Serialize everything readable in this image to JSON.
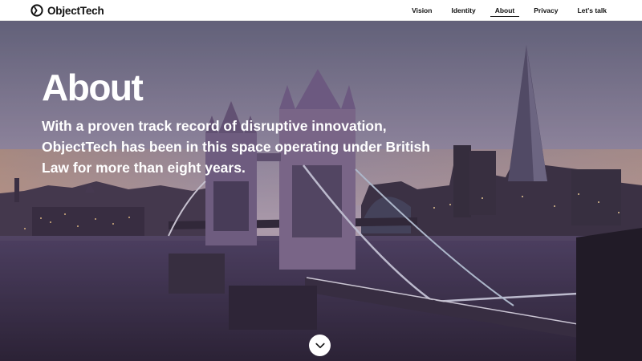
{
  "brand": {
    "name": "ObjectTech",
    "logo_icon": "objecttech-logo-icon"
  },
  "nav": {
    "items": [
      {
        "label": "Vision",
        "active": false
      },
      {
        "label": "Identity",
        "active": false
      },
      {
        "label": "About",
        "active": true
      },
      {
        "label": "Privacy",
        "active": false
      },
      {
        "label": "Let's talk",
        "active": false
      }
    ]
  },
  "hero": {
    "title": "About",
    "description": "With a proven track record of disruptive innovation, ObjectTech has been in this space operating under British Law for more than eight years.",
    "background": "london-tower-bridge-dusk-photo",
    "scroll_icon": "chevron-down-icon"
  },
  "colors": {
    "nav_background": "#ffffff",
    "text_on_hero": "#ffffff",
    "nav_text": "#111111"
  }
}
